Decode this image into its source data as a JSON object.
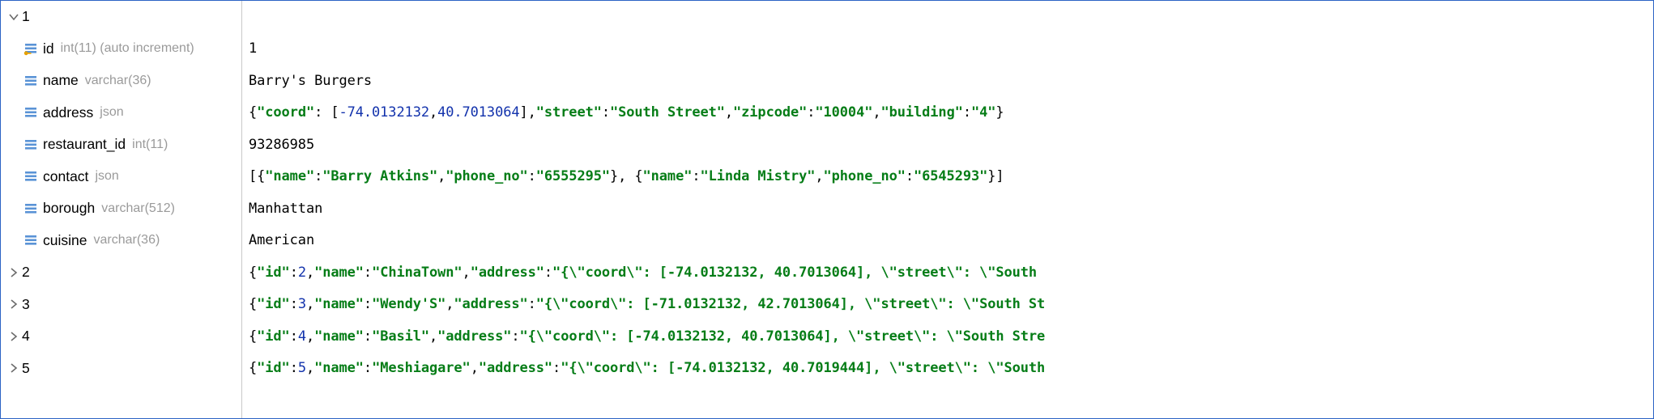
{
  "rows": [
    {
      "left_arrow": "down",
      "left_icon": null,
      "left_label": "1",
      "left_type": "",
      "value_plain": ""
    },
    {
      "left_arrow": null,
      "left_icon": "pk",
      "left_label": "id",
      "left_type": "int(11) (auto increment)",
      "value_plain": "1"
    },
    {
      "left_arrow": null,
      "left_icon": "col",
      "left_label": "name",
      "left_type": "varchar(36)",
      "value_plain": "Barry's Burgers"
    },
    {
      "left_arrow": null,
      "left_icon": "col",
      "left_label": "address",
      "left_type": "json",
      "value_tokens": [
        [
          "pun",
          "{"
        ],
        [
          "key",
          "\"coord\""
        ],
        [
          "pun",
          ": ["
        ],
        [
          "num",
          "-74.0132132"
        ],
        [
          "pun",
          ", "
        ],
        [
          "num",
          "40.7013064"
        ],
        [
          "pun",
          "], "
        ],
        [
          "key",
          "\"street\""
        ],
        [
          "pun",
          ": "
        ],
        [
          "str",
          "\"South Street\""
        ],
        [
          "pun",
          ", "
        ],
        [
          "key",
          "\"zipcode\""
        ],
        [
          "pun",
          ": "
        ],
        [
          "str",
          "\"10004\""
        ],
        [
          "pun",
          ", "
        ],
        [
          "key",
          "\"building\""
        ],
        [
          "pun",
          ": "
        ],
        [
          "str",
          "\"4\""
        ],
        [
          "pun",
          "}"
        ]
      ]
    },
    {
      "left_arrow": null,
      "left_icon": "col",
      "left_label": "restaurant_id",
      "left_type": "int(11)",
      "value_plain": "93286985"
    },
    {
      "left_arrow": null,
      "left_icon": "col",
      "left_label": "contact",
      "left_type": "json",
      "value_tokens": [
        [
          "pun",
          "[{"
        ],
        [
          "key",
          "\"name\""
        ],
        [
          "pun",
          ": "
        ],
        [
          "str",
          "\"Barry Atkins\""
        ],
        [
          "pun",
          ", "
        ],
        [
          "key",
          "\"phone_no\""
        ],
        [
          "pun",
          ": "
        ],
        [
          "str",
          "\"6555295\""
        ],
        [
          "pun",
          "}, {"
        ],
        [
          "key",
          "\"name\""
        ],
        [
          "pun",
          ": "
        ],
        [
          "str",
          "\"Linda Mistry\""
        ],
        [
          "pun",
          ", "
        ],
        [
          "key",
          "\"phone_no\""
        ],
        [
          "pun",
          ": "
        ],
        [
          "str",
          "\"6545293\""
        ],
        [
          "pun",
          "}]"
        ]
      ]
    },
    {
      "left_arrow": null,
      "left_icon": "col",
      "left_label": "borough",
      "left_type": "varchar(512)",
      "value_plain": "Manhattan"
    },
    {
      "left_arrow": null,
      "left_icon": "col",
      "left_label": "cuisine",
      "left_type": "varchar(36)",
      "value_plain": "American"
    },
    {
      "left_arrow": "right",
      "left_icon": null,
      "left_label": "2",
      "left_type": "",
      "value_tokens": [
        [
          "pun",
          "{"
        ],
        [
          "key",
          "\"id\""
        ],
        [
          "pun",
          ": "
        ],
        [
          "num",
          "2"
        ],
        [
          "pun",
          ", "
        ],
        [
          "key",
          "\"name\""
        ],
        [
          "pun",
          ": "
        ],
        [
          "str",
          "\"ChinaTown\""
        ],
        [
          "pun",
          ", "
        ],
        [
          "key",
          "\"address\""
        ],
        [
          "pun",
          ": "
        ],
        [
          "str",
          "\"{\\\"coord\\\": [-74.0132132, 40.7013064], \\\"street\\\": \\\"South"
        ]
      ]
    },
    {
      "left_arrow": "right",
      "left_icon": null,
      "left_label": "3",
      "left_type": "",
      "value_tokens": [
        [
          "pun",
          "{"
        ],
        [
          "key",
          "\"id\""
        ],
        [
          "pun",
          ": "
        ],
        [
          "num",
          "3"
        ],
        [
          "pun",
          ", "
        ],
        [
          "key",
          "\"name\""
        ],
        [
          "pun",
          ": "
        ],
        [
          "str",
          "\"Wendy'S\""
        ],
        [
          "pun",
          ", "
        ],
        [
          "key",
          "\"address\""
        ],
        [
          "pun",
          ": "
        ],
        [
          "str",
          "\"{\\\"coord\\\": [-71.0132132, 42.7013064], \\\"street\\\": \\\"South St"
        ]
      ]
    },
    {
      "left_arrow": "right",
      "left_icon": null,
      "left_label": "4",
      "left_type": "",
      "value_tokens": [
        [
          "pun",
          "{"
        ],
        [
          "key",
          "\"id\""
        ],
        [
          "pun",
          ": "
        ],
        [
          "num",
          "4"
        ],
        [
          "pun",
          ", "
        ],
        [
          "key",
          "\"name\""
        ],
        [
          "pun",
          ": "
        ],
        [
          "str",
          "\"Basil\""
        ],
        [
          "pun",
          ", "
        ],
        [
          "key",
          "\"address\""
        ],
        [
          "pun",
          ": "
        ],
        [
          "str",
          "\"{\\\"coord\\\": [-74.0132132, 40.7013064], \\\"street\\\": \\\"South Stre"
        ]
      ]
    },
    {
      "left_arrow": "right",
      "left_icon": null,
      "left_label": "5",
      "left_type": "",
      "value_tokens": [
        [
          "pun",
          "{"
        ],
        [
          "key",
          "\"id\""
        ],
        [
          "pun",
          ": "
        ],
        [
          "num",
          "5"
        ],
        [
          "pun",
          ", "
        ],
        [
          "key",
          "\"name\""
        ],
        [
          "pun",
          ": "
        ],
        [
          "str",
          "\"Meshiagare\""
        ],
        [
          "pun",
          ", "
        ],
        [
          "key",
          "\"address\""
        ],
        [
          "pun",
          ": "
        ],
        [
          "str",
          "\"{\\\"coord\\\": [-74.0132132, 40.7019444], \\\"street\\\": \\\"South"
        ]
      ]
    }
  ],
  "icons": {
    "pk_title": "primary-key-column-icon",
    "col_title": "column-icon"
  }
}
